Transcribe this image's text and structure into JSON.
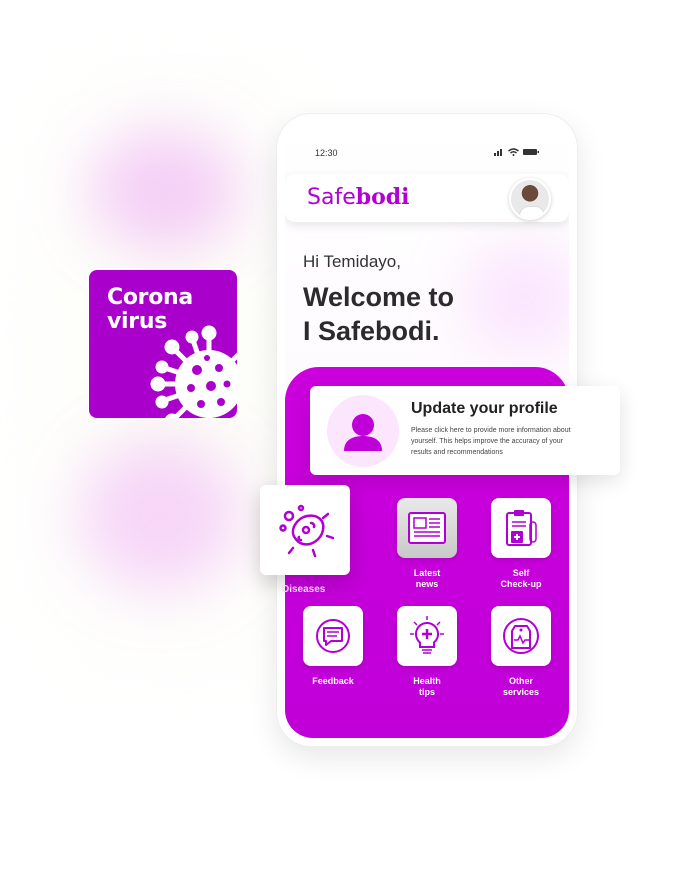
{
  "colors": {
    "brand": "#c000d8",
    "card_purple": "#aa00cc",
    "text_dark": "#2b2b2b"
  },
  "promo_card": {
    "title": "Corona\nvirus",
    "icon": "virus-icon"
  },
  "status_bar": {
    "time": "12:30",
    "icons": [
      "signal-icon",
      "wifi-icon",
      "battery-icon"
    ]
  },
  "app_header": {
    "logo_light": "Safe",
    "logo_bold": "bodi",
    "avatar": "user-photo"
  },
  "greeting": "Hi Temidayo,",
  "welcome": "Welcome to\nI Safebodi.",
  "profile_card": {
    "title": "Update your profile",
    "description": "Please click here to provide more information about yourself. This helps improve the accuracy of your results and recommendations",
    "icon": "person-icon"
  },
  "menu": {
    "diseases": {
      "label": "Diseases",
      "icon": "bacteria-icon"
    },
    "latest_news": {
      "label": "Latest\nnews",
      "icon": "newspaper-icon"
    },
    "self_checkup": {
      "label": "Self\nCheck-up",
      "icon": "clipboard-medical-icon"
    },
    "feedback": {
      "label": "Feedback",
      "icon": "feedback-chat-icon"
    },
    "health_tips": {
      "label": "Health\ntips",
      "icon": "lightbulb-cross-icon"
    },
    "other_services": {
      "label": "Other\nservices",
      "icon": "medical-tag-icon"
    }
  }
}
